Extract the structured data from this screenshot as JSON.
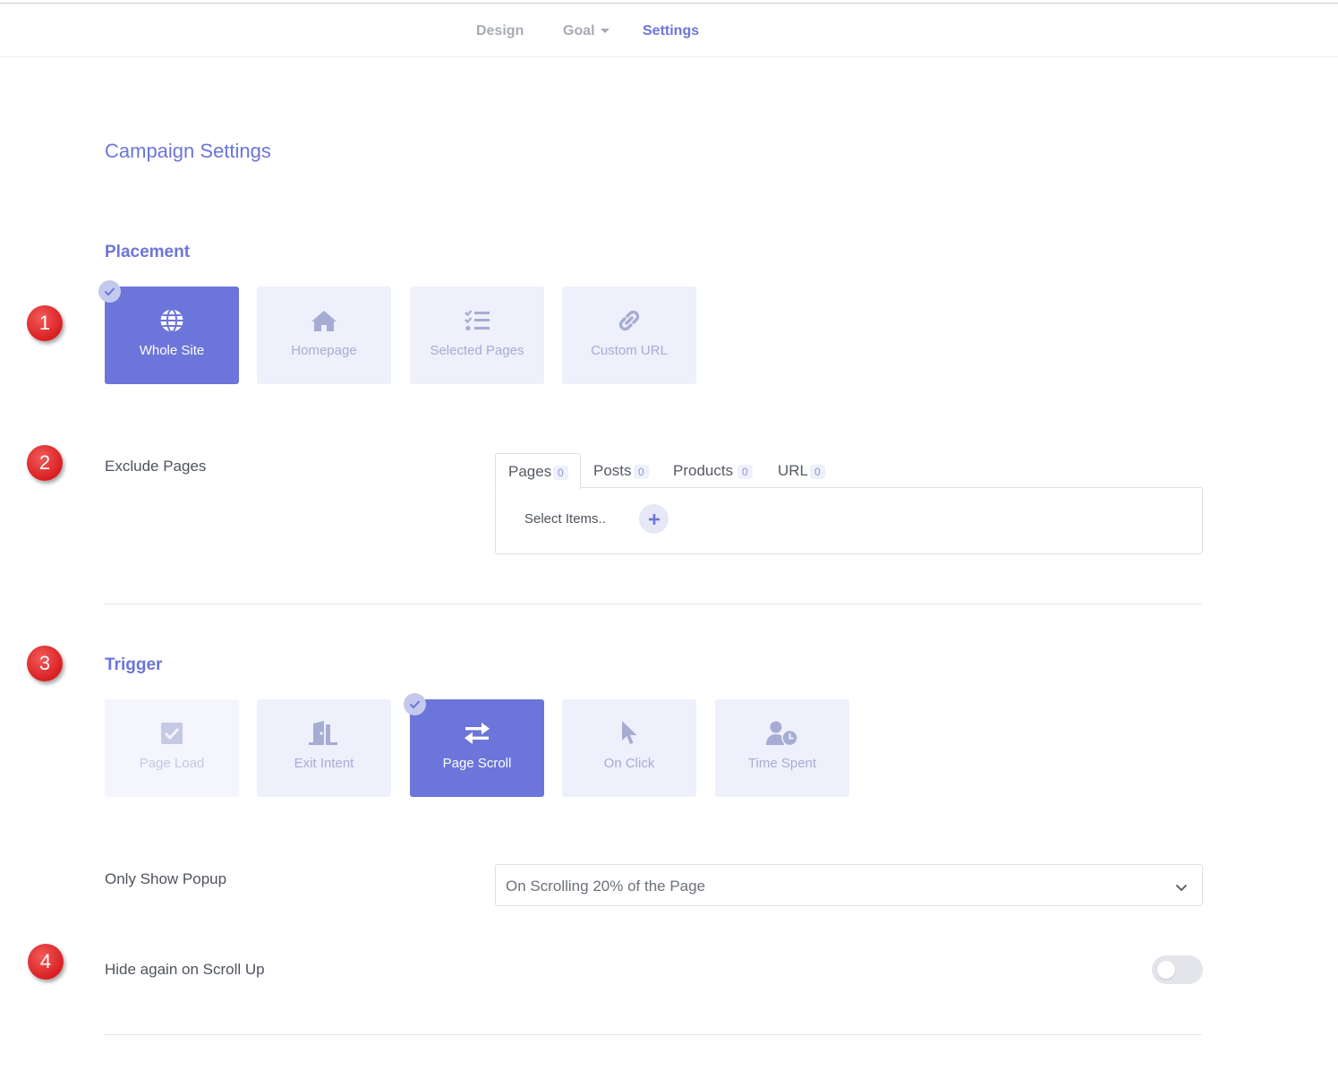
{
  "nav": {
    "design_label": "Design",
    "goal_label": "Goal",
    "settings_label": "Settings"
  },
  "page_title": "Campaign Settings",
  "steps": [
    "1",
    "2",
    "3",
    "4"
  ],
  "placement": {
    "title": "Placement",
    "options": [
      {
        "label": "Whole Site",
        "icon": "globe-icon",
        "selected": true
      },
      {
        "label": "Homepage",
        "icon": "home-icon",
        "selected": false
      },
      {
        "label": "Selected Pages",
        "icon": "checklist-icon",
        "selected": false
      },
      {
        "label": "Custom URL",
        "icon": "link-icon",
        "selected": false
      }
    ]
  },
  "exclude": {
    "label": "Exclude Pages",
    "tabs": [
      {
        "label": "Pages",
        "count": "0",
        "active": true
      },
      {
        "label": "Posts",
        "count": "0",
        "active": false
      },
      {
        "label": "Products",
        "count": "0",
        "active": false
      },
      {
        "label": "URL",
        "count": "0",
        "active": false
      }
    ],
    "select_text": "Select Items.."
  },
  "trigger": {
    "title": "Trigger",
    "options": [
      {
        "label": "Page Load",
        "icon": "checkbox-icon",
        "selected": false,
        "disabled": true
      },
      {
        "label": "Exit Intent",
        "icon": "door-exit-icon",
        "selected": false
      },
      {
        "label": "Page Scroll",
        "icon": "arrows-exchange-icon",
        "selected": true
      },
      {
        "label": "On Click",
        "icon": "cursor-icon",
        "selected": false
      },
      {
        "label": "Time Spent",
        "icon": "user-clock-icon",
        "selected": false
      }
    ]
  },
  "only_show": {
    "label": "Only Show Popup",
    "value": "On Scrolling 20% of the Page"
  },
  "hide_scroll": {
    "label": "Hide again on Scroll Up",
    "enabled": false
  },
  "colors": {
    "accent": "#6c75d9",
    "card_bg": "#eef0fb",
    "step_badge": "#e02424"
  }
}
